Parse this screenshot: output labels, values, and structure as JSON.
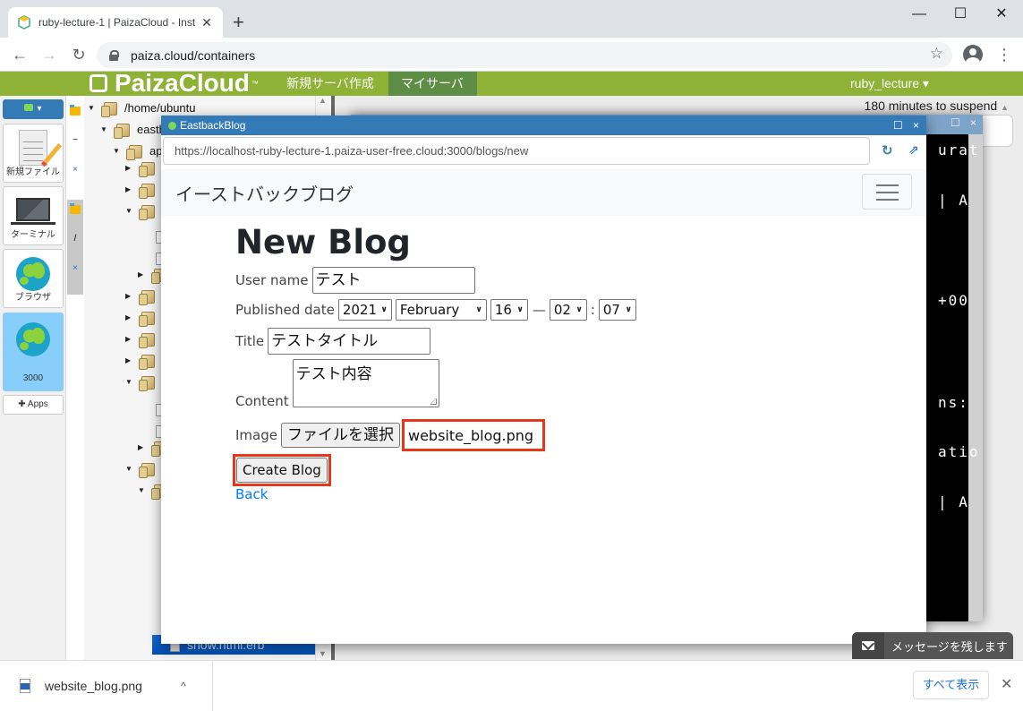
{
  "browser": {
    "tab_title": "ruby-lecture-1 | PaizaCloud - Inst",
    "tab_close": "✕",
    "new_tab": "+",
    "url": "paiza.cloud/containers",
    "back": "←",
    "forward": "→",
    "reload": "↻",
    "star": "☆",
    "menu": "⋮",
    "minimize": "—",
    "maximize": "☐",
    "close": "✕"
  },
  "paiza_header": {
    "logo": "PaizaCloud",
    "logo_tm": "™",
    "nav": [
      {
        "label": "新規サーバ作成",
        "active": false
      },
      {
        "label": "マイサーバ",
        "active": true
      }
    ],
    "user": "ruby_lecture ▾"
  },
  "left_bar": {
    "new_dropdown": "▾",
    "apps": [
      {
        "label": "新規ファイル",
        "icon": "new-file-icon"
      },
      {
        "label": "ターミナル",
        "icon": "terminal-icon"
      },
      {
        "label": "ブラウザ",
        "icon": "globe-icon"
      },
      {
        "label": "3000",
        "icon": "globe-icon",
        "active": true
      }
    ],
    "apps_button": "✚ Apps"
  },
  "vertical_tabs": [
    {
      "label": "~",
      "close": "×"
    },
    {
      "label": "/",
      "close": "×"
    }
  ],
  "file_tree": {
    "root": "/home/ubuntu",
    "items": [
      {
        "label": "/home/ubuntu",
        "type": "folder",
        "expanded": true,
        "depth": 0
      },
      {
        "label": "eastbackblog",
        "type": "folder",
        "expanded": true,
        "depth": 1
      },
      {
        "label": "app",
        "type": "folder",
        "expanded": true,
        "depth": 2
      }
    ],
    "selected_file": "show.html.erb"
  },
  "workspace": {
    "suspend_text": "180 minutes to suspend",
    "terminal_fragments": [
      "urat",
      "| A",
      "+00",
      "ns:",
      "atio",
      "| A"
    ]
  },
  "popup": {
    "title": "EastbackBlog",
    "maximize": "☐",
    "close": "×",
    "url": "https://localhost-ruby-lecture-1.paiza-user-free.cloud:3000/blogs/new",
    "reload_icon": "↻",
    "external_icon": "⇗"
  },
  "site": {
    "brand": "イーストバックブログ",
    "heading": "New Blog",
    "form": {
      "user_name_label": "User name",
      "user_name_value": "テスト",
      "published_date_label": "Published date",
      "year": "2021",
      "month": "February",
      "day": "16",
      "date_time_separator": "—",
      "hour": "02",
      "time_separator": ":",
      "minute": "07",
      "title_label": "Title",
      "title_value": "テストタイトル",
      "content_label": "Content",
      "content_value": "テスト内容",
      "image_label": "Image",
      "file_button": "ファイルを選択",
      "file_name": "website_blog.png",
      "submit": "Create Blog",
      "back": "Back"
    }
  },
  "message_widget": {
    "text": "メッセージを残します"
  },
  "downloads": {
    "file_name": "website_blog.png",
    "chevron": "^",
    "show_all": "すべて表示",
    "close": "✕"
  }
}
